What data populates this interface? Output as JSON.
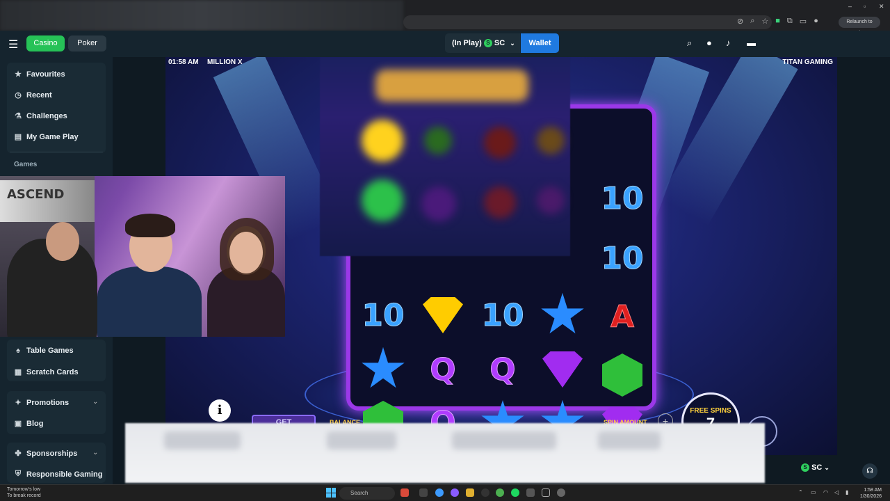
{
  "browser": {
    "relaunch_label": "Relaunch to update",
    "window_controls": [
      "–",
      "▫",
      "✕"
    ]
  },
  "header": {
    "tabs": [
      {
        "label": "Casino",
        "active": true
      },
      {
        "label": "Poker",
        "active": false
      }
    ],
    "play_mode": "(In Play)",
    "currency": "SC",
    "currency_badge": "S",
    "wallet_label": "Wallet",
    "icons": [
      "search-icon",
      "user-icon",
      "bell-icon",
      "chat-icon"
    ],
    "accent_color": "#26c257",
    "wallet_color": "#1f7ae0"
  },
  "sidebar": {
    "top_items": [
      {
        "label": "Favourites",
        "icon": "star-icon",
        "glyph": "★"
      },
      {
        "label": "Recent",
        "icon": "clock-icon",
        "glyph": "◷"
      },
      {
        "label": "Challenges",
        "icon": "flask-icon",
        "glyph": "⚗"
      },
      {
        "label": "My Game Play",
        "icon": "card-icon",
        "glyph": "▤"
      }
    ],
    "games_header": "Games",
    "game_items": [
      {
        "label": "Table Games",
        "icon": "table-icon",
        "glyph": "♠"
      },
      {
        "label": "Scratch Cards",
        "icon": "grid-icon",
        "glyph": "▦"
      }
    ],
    "bottom_items": [
      {
        "label": "Promotions",
        "icon": "gift-icon",
        "glyph": "✦"
      },
      {
        "label": "Blog",
        "icon": "document-icon",
        "glyph": "▣"
      },
      {
        "label": "Sponsorships",
        "icon": "handshake-icon",
        "glyph": "✤"
      },
      {
        "label": "Responsible Gaming",
        "icon": "shield-icon",
        "glyph": "⛨"
      }
    ]
  },
  "game": {
    "time": "01:58 AM",
    "title": "MILLION X",
    "provider": "TITAN GAMING",
    "free_spins_label": "FREE SPINS",
    "free_spins_value": "7",
    "balance_label": "BALANCE",
    "spin_amount_label": "SPIN AMOUNT",
    "get_label": "GET",
    "info_label": "i"
  },
  "footer": {
    "currency": "SC"
  },
  "webcam": {
    "banner_text": "ASCEND"
  },
  "taskbar": {
    "weather_line1": "Tomorrow's low",
    "weather_line2": "To break record",
    "search_placeholder": "Search",
    "time": "1:58 AM",
    "date": "1/30/2026"
  }
}
